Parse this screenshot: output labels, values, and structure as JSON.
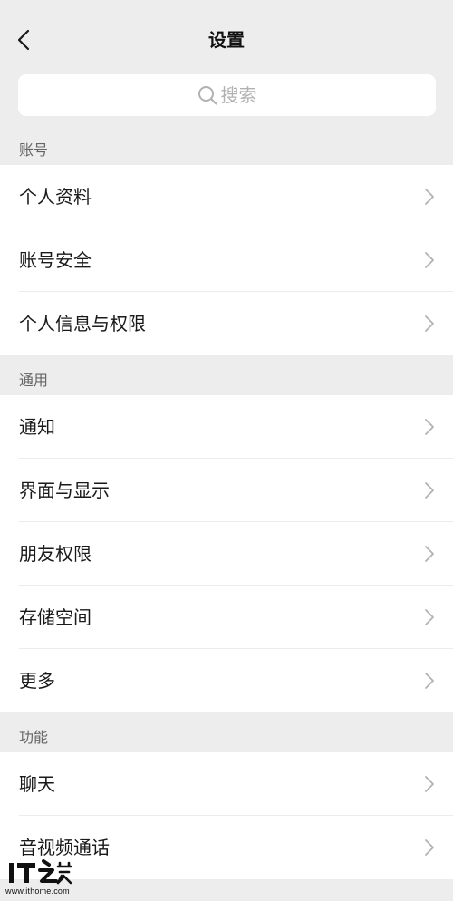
{
  "header": {
    "title": "设置"
  },
  "search": {
    "placeholder": "搜索"
  },
  "sections": {
    "account": {
      "label": "账号",
      "items": [
        "个人资料",
        "账号安全",
        "个人信息与权限"
      ]
    },
    "general": {
      "label": "通用",
      "items": [
        "通知",
        "界面与显示",
        "朋友权限",
        "存储空间",
        "更多"
      ]
    },
    "features": {
      "label": "功能",
      "items": [
        "聊天",
        "音视频通话"
      ]
    }
  },
  "watermark": {
    "logo_text": "IT之家",
    "url": "www.ithome.com"
  }
}
